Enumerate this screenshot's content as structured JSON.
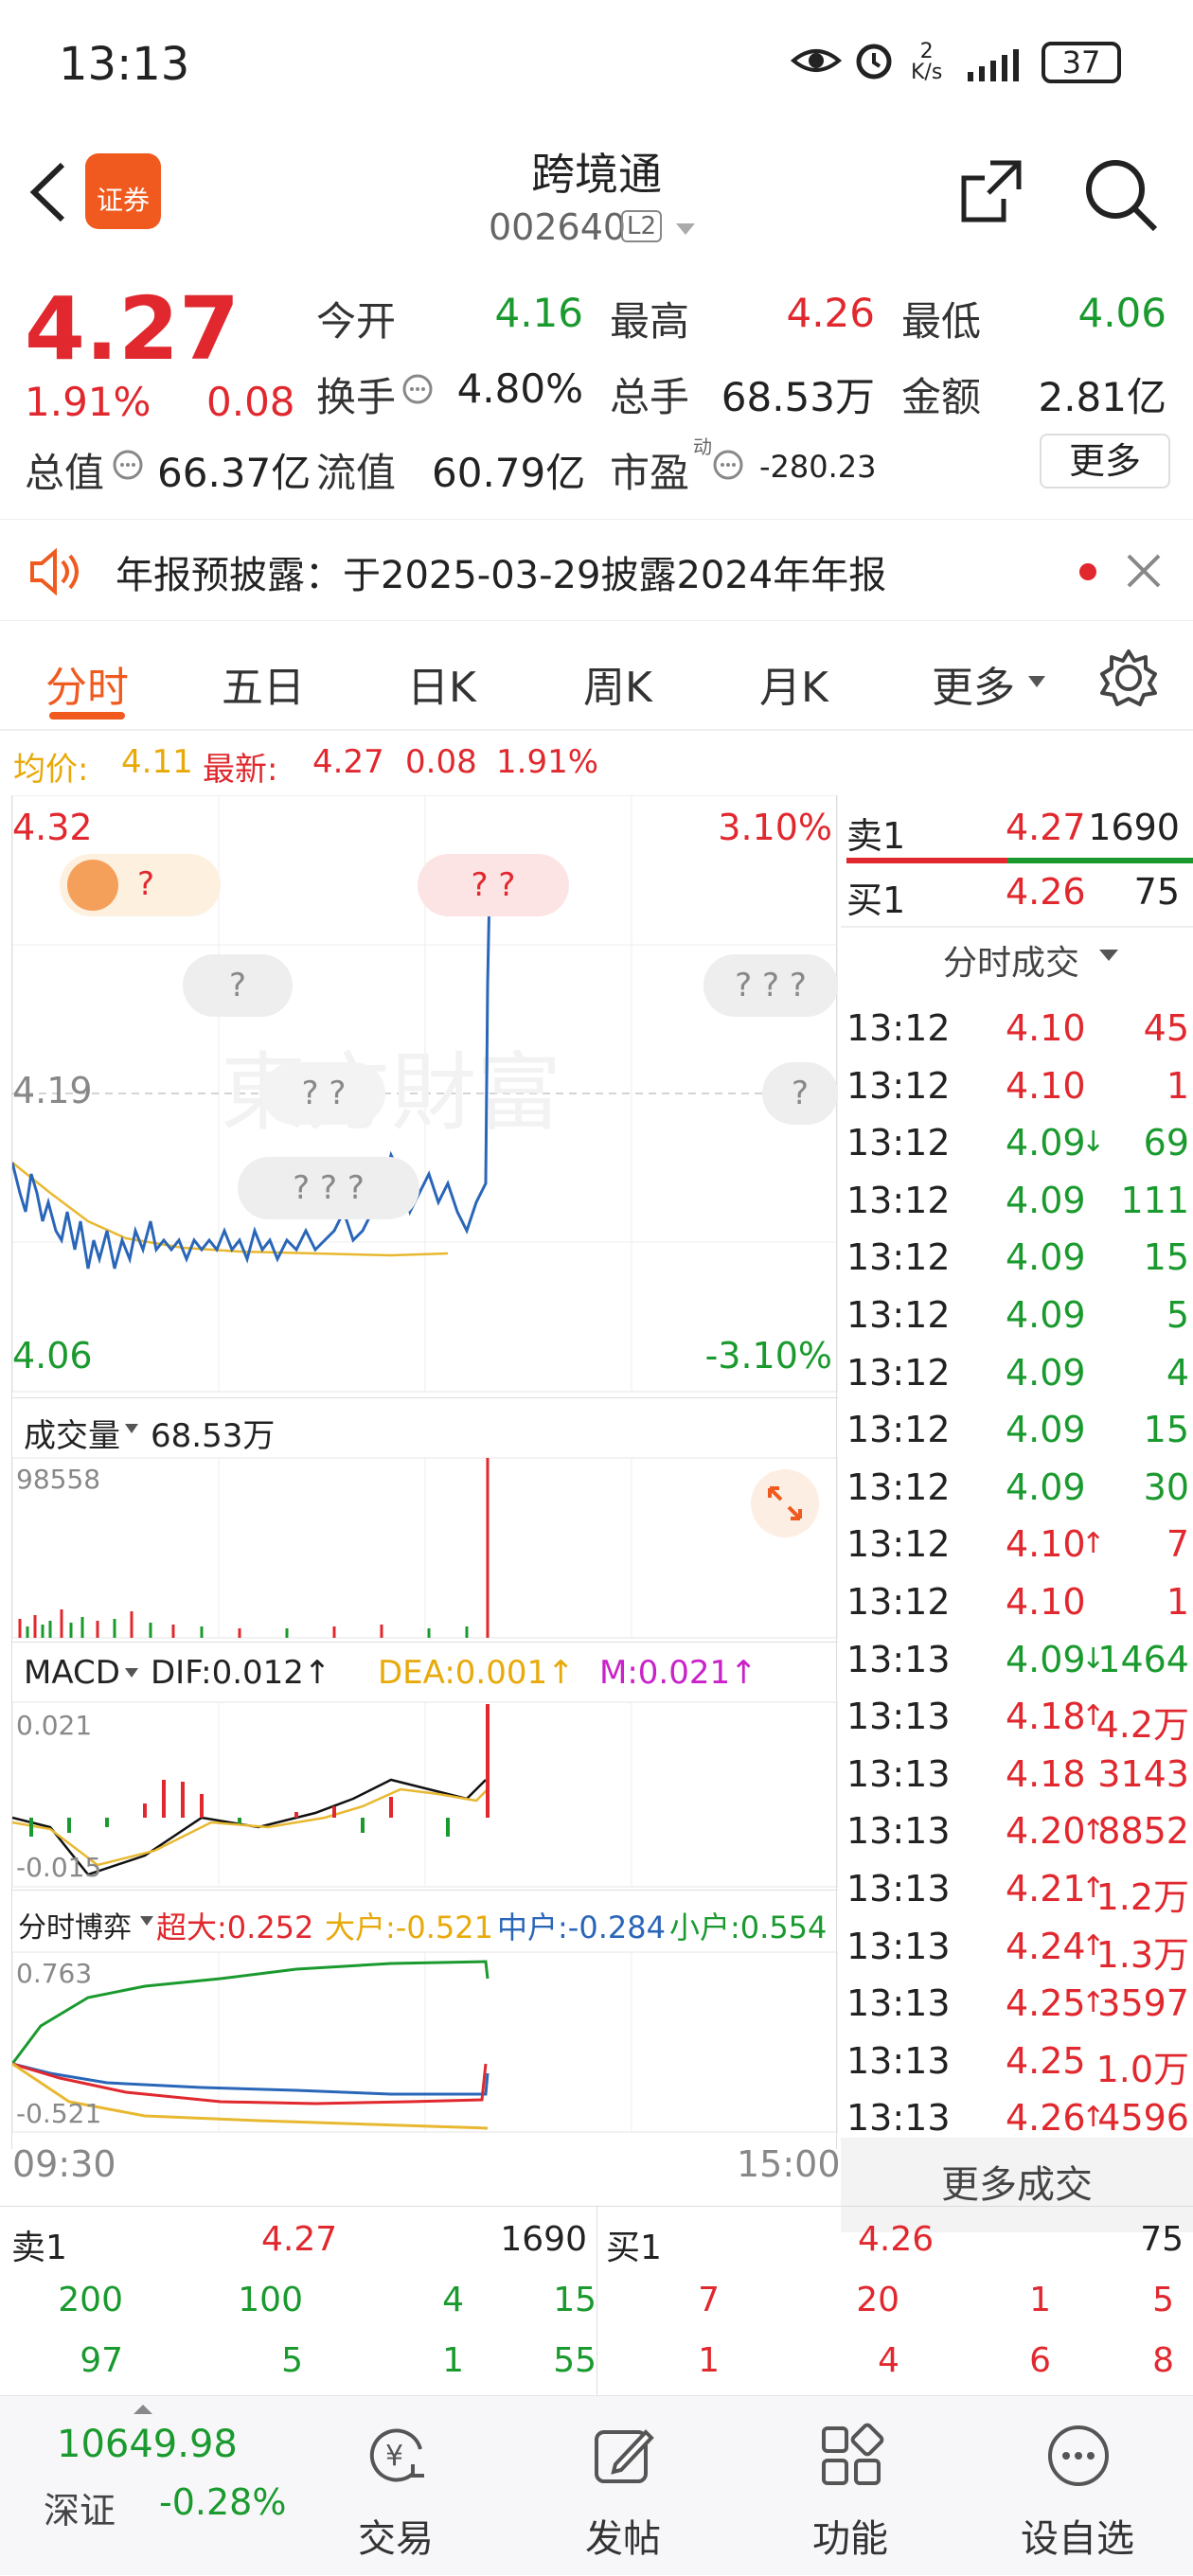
{
  "status": {
    "time": "13:13",
    "speed_top": "2",
    "speed_bottom": "K/s",
    "battery": "37"
  },
  "header": {
    "title": "跨境通",
    "code": "002640",
    "level": "L2",
    "logo": "证券"
  },
  "quote": {
    "price": "4.27",
    "pct": "1.91%",
    "change": "0.08",
    "r1": [
      [
        "今开",
        "4.16",
        "green"
      ],
      [
        "最高",
        "4.26",
        "red"
      ],
      [
        "最低",
        "4.06",
        "green"
      ]
    ],
    "r2": [
      [
        "换手",
        "4.80%",
        "dark"
      ],
      [
        "总手",
        "68.53万",
        "dark"
      ],
      [
        "金额",
        "2.81亿",
        "dark"
      ]
    ],
    "total_label": "总值",
    "total_value": "66.37亿",
    "float_label": "流值",
    "float_value": "60.79亿",
    "pe_label": "市盈",
    "pe_sup": "动",
    "pe_value": "-280.23",
    "more": "更多"
  },
  "notice": {
    "text": "年报预披露：于2025-03-29披露2024年年报"
  },
  "tabs": [
    "分时",
    "五日",
    "日K",
    "周K",
    "月K",
    "更多"
  ],
  "avg": {
    "avg_label": "均价:",
    "avg_value": "4.11",
    "latest_label": "最新:",
    "latest_value": "4.27",
    "change": "0.08",
    "pct": "1.91%"
  },
  "chart": {
    "top_left": "4.32",
    "top_right": "3.10%",
    "mid": "4.19",
    "bottom_left": "4.06",
    "bottom_right": "-3.10%",
    "volume_label": "成交量",
    "volume_total": "68.53万",
    "volume_max": "98558",
    "macd_label": "MACD",
    "dif": "DIF:0.012↑",
    "dea": "DEA:0.001↑",
    "m": "M:0.021↑",
    "macd_top": "0.021",
    "macd_bottom": "-0.015",
    "flow_label": "分时博弈",
    "super": "超大:0.252",
    "big": "大户:-0.521",
    "mid_flow": "中户:-0.284",
    "small": "小户:0.554",
    "flow_top": "0.763",
    "flow_bottom": "-0.521",
    "time_start": "09:30",
    "time_end": "15:00",
    "watermark": "东方财富",
    "pills": [
      "?",
      "? ?",
      "?",
      "? ? ?",
      "? ?",
      "? ? ?",
      "?"
    ]
  },
  "book": {
    "sell_label": "卖1",
    "sell_price": "4.27",
    "sell_vol": "1690",
    "buy_label": "买1",
    "buy_price": "4.26",
    "buy_vol": "75",
    "ticks_title": "分时成交",
    "more_trades": "更多成交"
  },
  "ticks": [
    [
      "13:12",
      "4.10",
      "",
      "45",
      "red"
    ],
    [
      "13:12",
      "4.10",
      "",
      "1",
      "red"
    ],
    [
      "13:12",
      "4.09",
      "↓",
      "69",
      "green"
    ],
    [
      "13:12",
      "4.09",
      "",
      "111",
      "green"
    ],
    [
      "13:12",
      "4.09",
      "",
      "15",
      "green"
    ],
    [
      "13:12",
      "4.09",
      "",
      "5",
      "green"
    ],
    [
      "13:12",
      "4.09",
      "",
      "4",
      "green"
    ],
    [
      "13:12",
      "4.09",
      "",
      "15",
      "green"
    ],
    [
      "13:12",
      "4.09",
      "",
      "30",
      "green"
    ],
    [
      "13:12",
      "4.10",
      "↑",
      "7",
      "red"
    ],
    [
      "13:12",
      "4.10",
      "",
      "1",
      "red"
    ],
    [
      "13:13",
      "4.09",
      "↓",
      "1464",
      "green"
    ],
    [
      "13:13",
      "4.18",
      "↑",
      "4.2万",
      "red"
    ],
    [
      "13:13",
      "4.18",
      "",
      "3143",
      "red"
    ],
    [
      "13:13",
      "4.20",
      "↑",
      "8852",
      "red"
    ],
    [
      "13:13",
      "4.21",
      "↑",
      "1.2万",
      "red"
    ],
    [
      "13:13",
      "4.24",
      "↑",
      "1.3万",
      "red"
    ],
    [
      "13:13",
      "4.25",
      "↑",
      "3597",
      "red"
    ],
    [
      "13:13",
      "4.25",
      "",
      "1.0万",
      "red"
    ],
    [
      "13:13",
      "4.26",
      "↑",
      "4596",
      "red"
    ]
  ],
  "bottom_book": {
    "sell_label": "卖1",
    "sell_price": "4.27",
    "sell_vol": "1690",
    "buy_label": "买1",
    "buy_price": "4.26",
    "buy_vol": "75",
    "sell_rows": [
      [
        "200",
        "100",
        "4",
        "15"
      ],
      [
        "97",
        "5",
        "1",
        "55"
      ]
    ],
    "buy_rows": [
      [
        "7",
        "20",
        "1",
        "5"
      ],
      [
        "1",
        "4",
        "6",
        "8"
      ]
    ]
  },
  "bottom_nav": {
    "index_value": "10649.98",
    "index_name": "深证",
    "index_pct": "-0.28%",
    "items": [
      "交易",
      "发帖",
      "功能",
      "设自选"
    ]
  },
  "colors": {
    "up": "#e0282e",
    "down": "#1a9a2e",
    "accent": "#f05a1e"
  }
}
